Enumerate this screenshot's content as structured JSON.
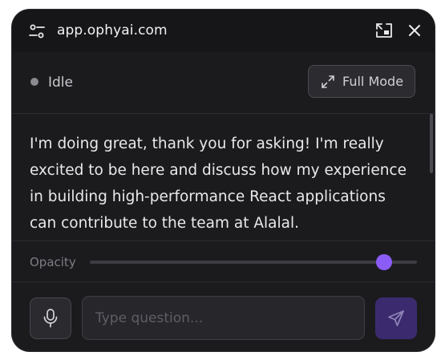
{
  "window": {
    "title": "app.ophyai.com",
    "icons": {
      "settings": "settings-sliders-icon",
      "expand": "expand-icon",
      "close": "close-icon"
    }
  },
  "status": {
    "text": "Idle",
    "dot_color": "#8a8a90"
  },
  "full_mode": {
    "label": "Full Mode",
    "icon": "arrows-expand-icon"
  },
  "message": {
    "text": "I'm doing great, thank you for asking! I'm really excited to be here and discuss how my experience in building high-performance React applications can contribute to the team at Alalal."
  },
  "opacity": {
    "label": "Opacity",
    "value": 0.9,
    "accent_color": "#8b5cf6"
  },
  "input": {
    "placeholder": "Type question...",
    "value": ""
  },
  "buttons": {
    "mic_icon": "microphone-icon",
    "send_icon": "send-icon"
  },
  "colors": {
    "window_bg": "#1b1b1e",
    "titlebar_bg": "#161618",
    "send_bg": "#3b2b6e"
  }
}
